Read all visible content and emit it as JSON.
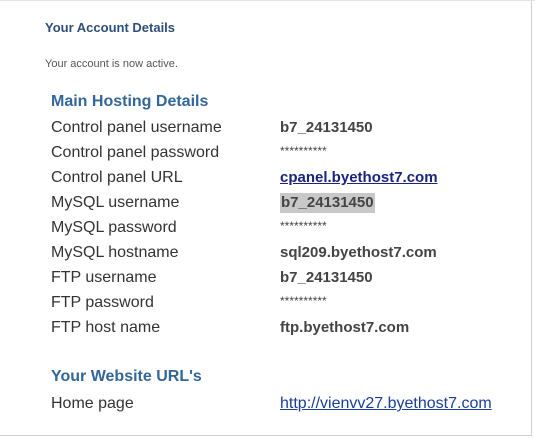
{
  "account": {
    "title": "Your Account Details",
    "status": "Your account is now active."
  },
  "hosting": {
    "heading": "Main Hosting Details",
    "rows": [
      {
        "label": "Control panel username",
        "value": "b7_24131450"
      },
      {
        "label": "Control panel password",
        "value": "**********"
      },
      {
        "label": "Control panel URL",
        "value": "cpanel.byethost7.com"
      },
      {
        "label": "MySQL username",
        "value": "b7_24131450"
      },
      {
        "label": "MySQL password",
        "value": "**********"
      },
      {
        "label": "MySQL hostname",
        "value": "sql209.byethost7.com"
      },
      {
        "label": "FTP username",
        "value": "b7_24131450"
      },
      {
        "label": "FTP password",
        "value": "**********"
      },
      {
        "label": "FTP host name",
        "value": "ftp.byethost7.com"
      }
    ]
  },
  "website": {
    "heading": "Your Website URL's",
    "rows": [
      {
        "label": "Home page",
        "value": "http://vienvv27.byethost7.com"
      }
    ]
  },
  "colors": {
    "title": "#2e4f7a",
    "heading": "#336699",
    "link": "#1a237e",
    "highlight": "#c8c8c8"
  }
}
